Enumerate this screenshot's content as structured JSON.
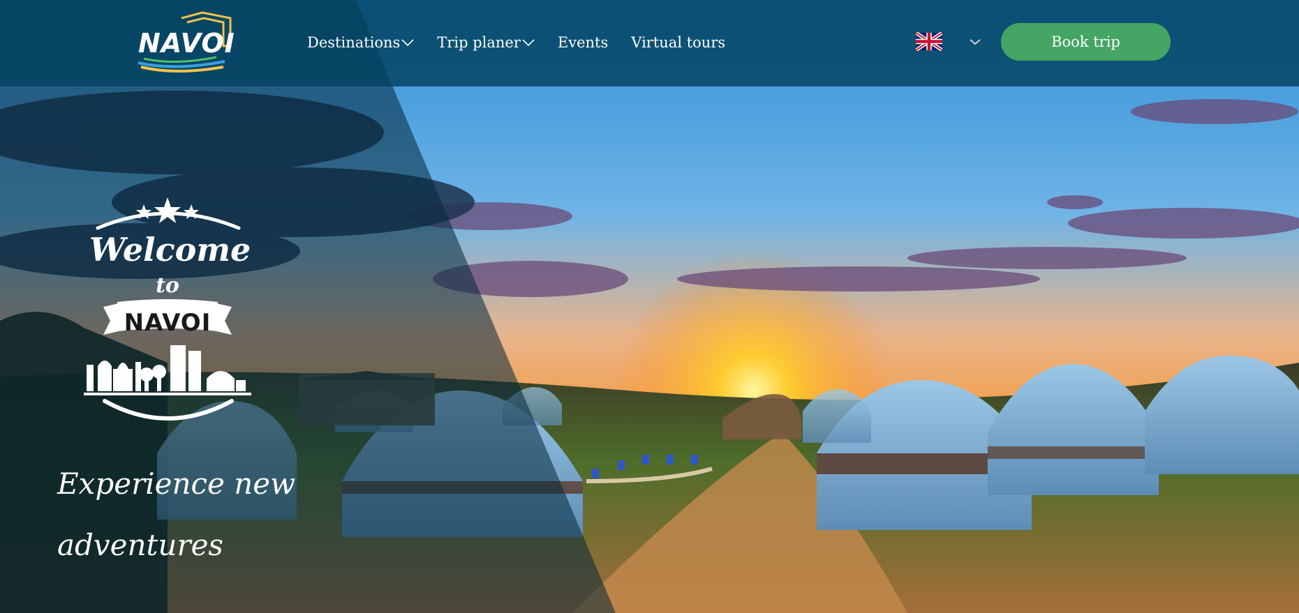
{
  "header": {
    "logo_text": "NAVOI",
    "nav": [
      {
        "label": "Destinations",
        "has_dropdown": true
      },
      {
        "label": "Trip planer",
        "has_dropdown": true
      },
      {
        "label": "Events",
        "has_dropdown": false
      },
      {
        "label": "Virtual tours",
        "has_dropdown": false
      }
    ],
    "language": {
      "icon": "uk-flag-icon",
      "dropdown_icon": "chevron-down-icon"
    },
    "book_button": "Book trip"
  },
  "hero": {
    "emblem": {
      "welcome": "Welcome",
      "to": "to",
      "city": "NAVOI"
    },
    "tagline": [
      "Experience new",
      "adventures"
    ]
  },
  "colors": {
    "header_bg": "#02425e",
    "book_button_bg": "#44a564",
    "text": "#ffffff"
  }
}
